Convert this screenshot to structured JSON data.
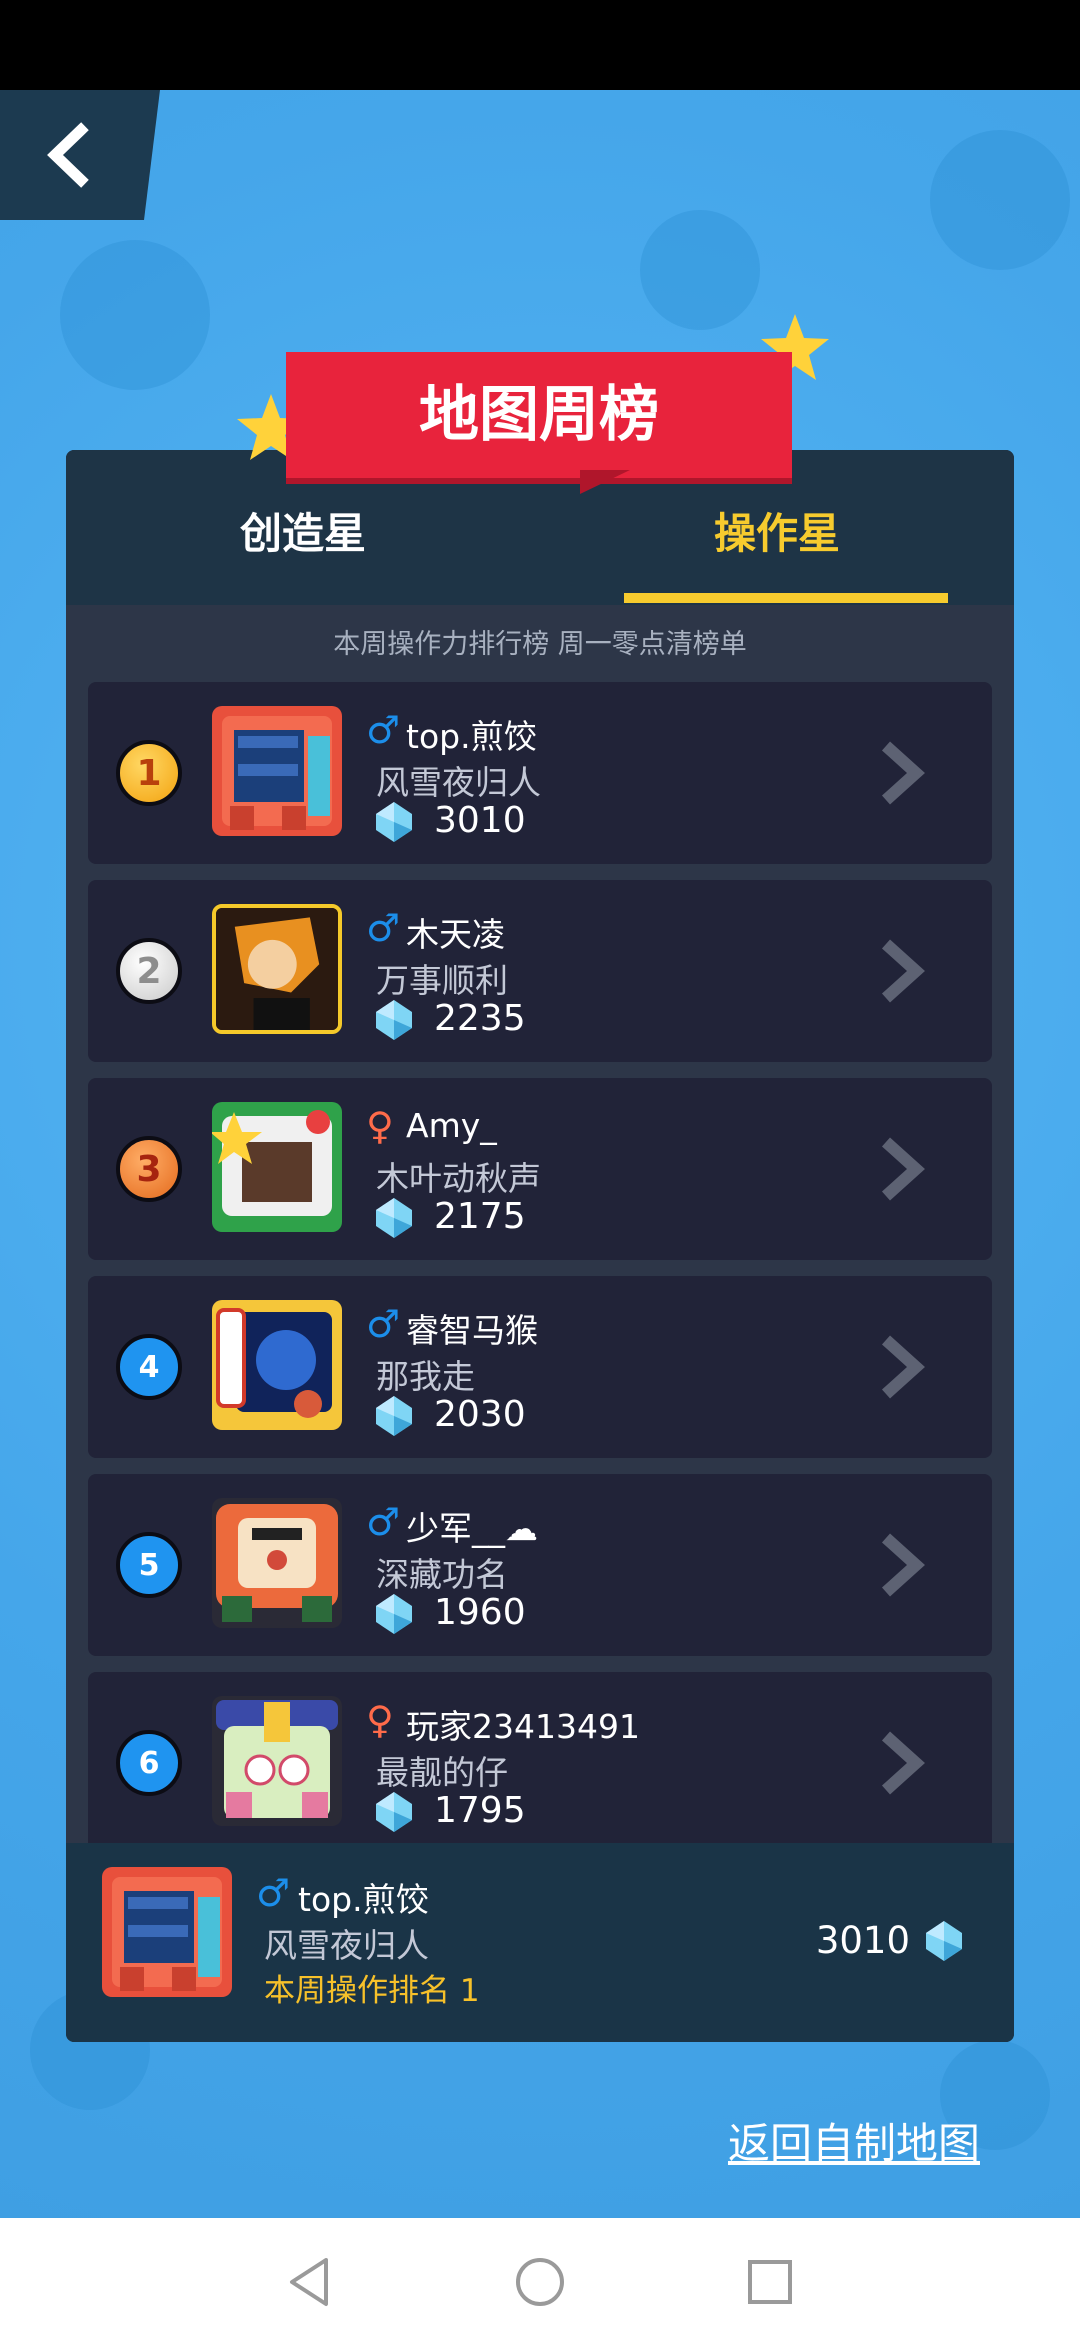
{
  "header": {
    "title": "地图周榜"
  },
  "tabs": [
    {
      "label": "创造星",
      "active": false
    },
    {
      "label": "操作星",
      "active": true
    }
  ],
  "subtitle": "本周操作力排行榜 周一零点清榜单",
  "rankings": [
    {
      "rank": "1",
      "gender": "♂",
      "name": "top.煎饺",
      "motto": "风雪夜归人",
      "score": "3010"
    },
    {
      "rank": "2",
      "gender": "♂",
      "name": "木天凌",
      "motto": "万事顺利",
      "score": "2235"
    },
    {
      "rank": "3",
      "gender": "♀",
      "name": "Amy_",
      "motto": "木叶动秋声",
      "score": "2175"
    },
    {
      "rank": "4",
      "gender": "♂",
      "name": "睿智马猴",
      "motto": "那我走",
      "score": "2030"
    },
    {
      "rank": "5",
      "gender": "♂",
      "name": "少军__☁",
      "motto": "深藏功名",
      "score": "1960"
    },
    {
      "rank": "6",
      "gender": "♀",
      "name": "玩家23413491",
      "motto": "最靓的仔",
      "score": "1795"
    }
  ],
  "my_entry": {
    "gender": "♂",
    "name": "top.煎饺",
    "motto": "风雪夜归人",
    "rank_text": "本周操作排名 1",
    "score": "3010"
  },
  "footer": {
    "return_link": "返回自制地图"
  },
  "colors": {
    "accent": "#f7cb2e",
    "banner": "#e8233c",
    "male": "#1c8eea",
    "female": "#ff6b4a"
  }
}
